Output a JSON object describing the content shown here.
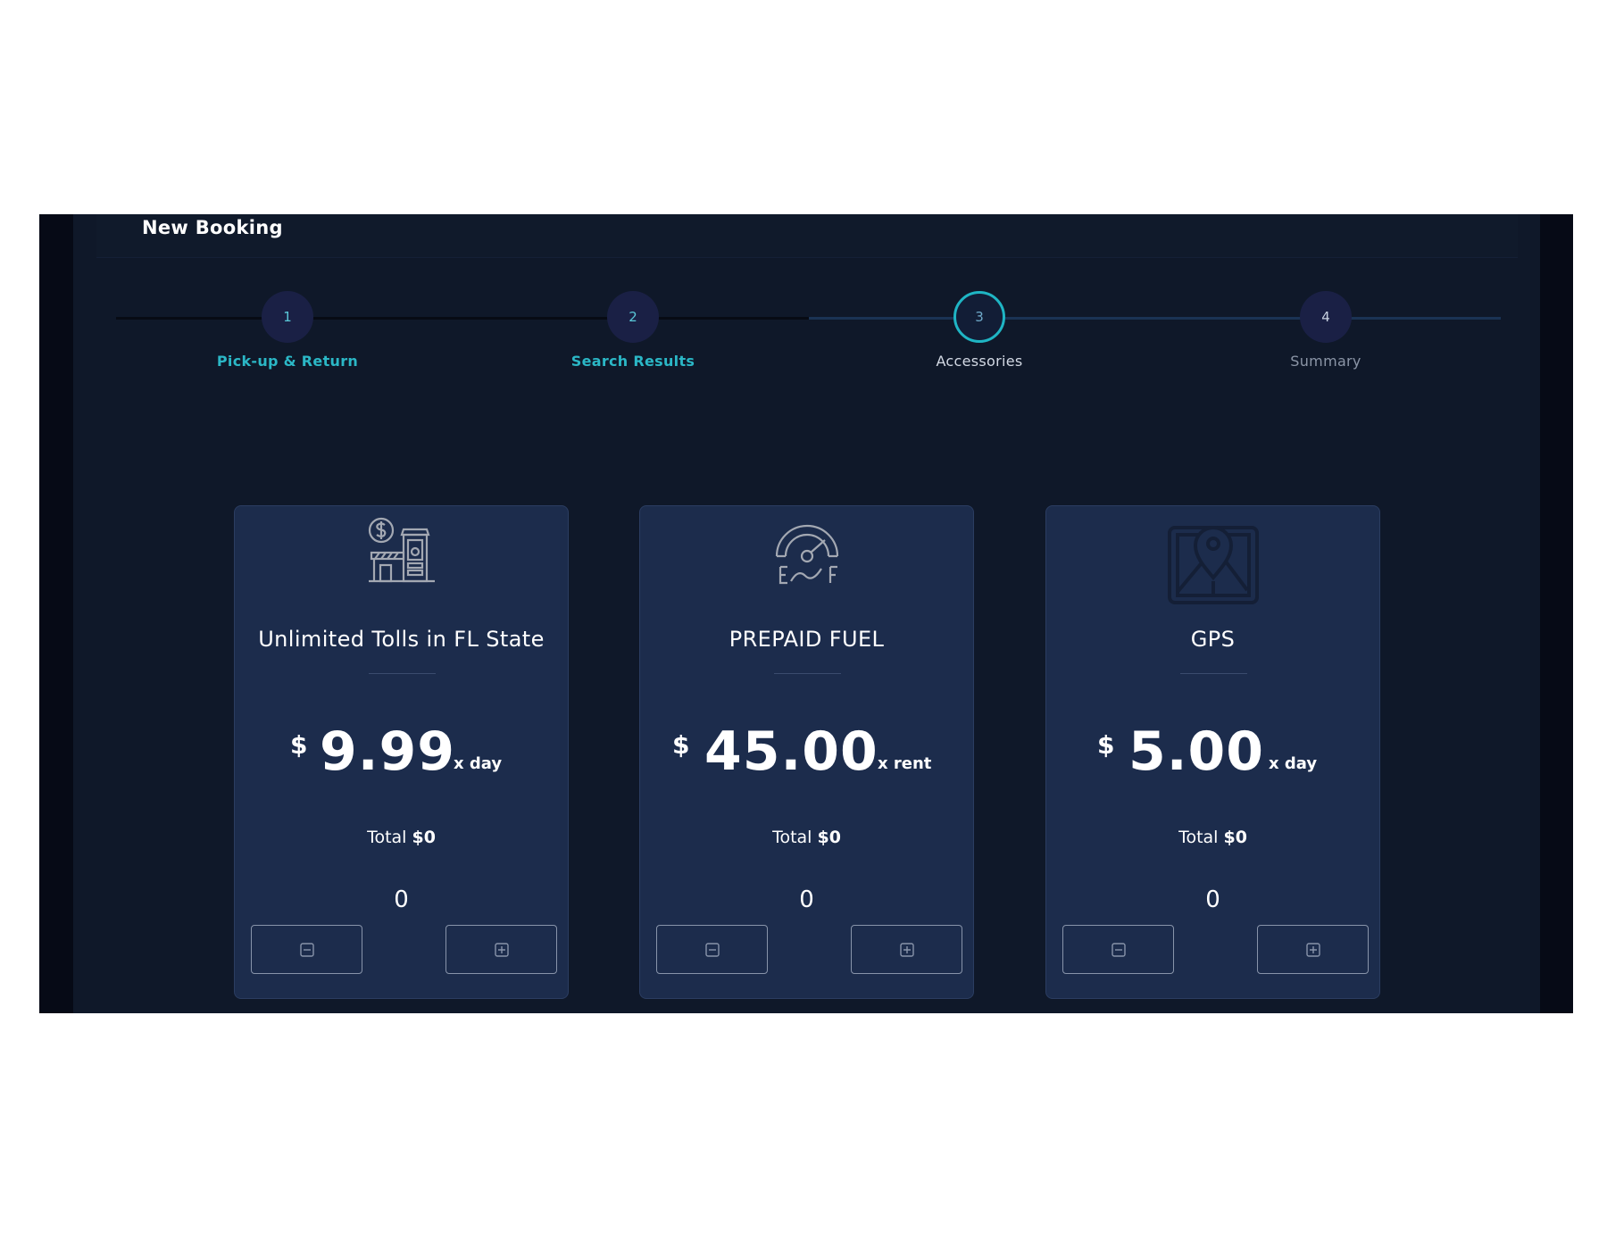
{
  "page": {
    "title": "New Booking"
  },
  "stepper": {
    "steps": [
      {
        "number": "1",
        "label": "Pick-up & Return",
        "state": "done"
      },
      {
        "number": "2",
        "label": "Search Results",
        "state": "done"
      },
      {
        "number": "3",
        "label": "Accessories",
        "state": "current"
      },
      {
        "number": "4",
        "label": "Summary",
        "state": "upcoming"
      }
    ]
  },
  "accessories": [
    {
      "icon": "toll-booth-icon",
      "title": "Unlimited Tolls in FL State",
      "currency": "$",
      "price": "9.99",
      "unit": "x day",
      "total_label": "Total",
      "total_value": "$0",
      "quantity": "0"
    },
    {
      "icon": "fuel-gauge-icon",
      "title": "PREPAID FUEL",
      "currency": "$",
      "price": "45.00",
      "unit": "x rent",
      "total_label": "Total",
      "total_value": "$0",
      "quantity": "0"
    },
    {
      "icon": "map-pin-icon",
      "title": "GPS",
      "currency": "$",
      "price": "5.00",
      "unit": "x day",
      "total_label": "Total",
      "total_value": "$0",
      "quantity": "0"
    }
  ],
  "colors": {
    "accent": "#1fb5c4",
    "card_bg": "#1c2c4c",
    "panel_bg": "#0f1829"
  }
}
